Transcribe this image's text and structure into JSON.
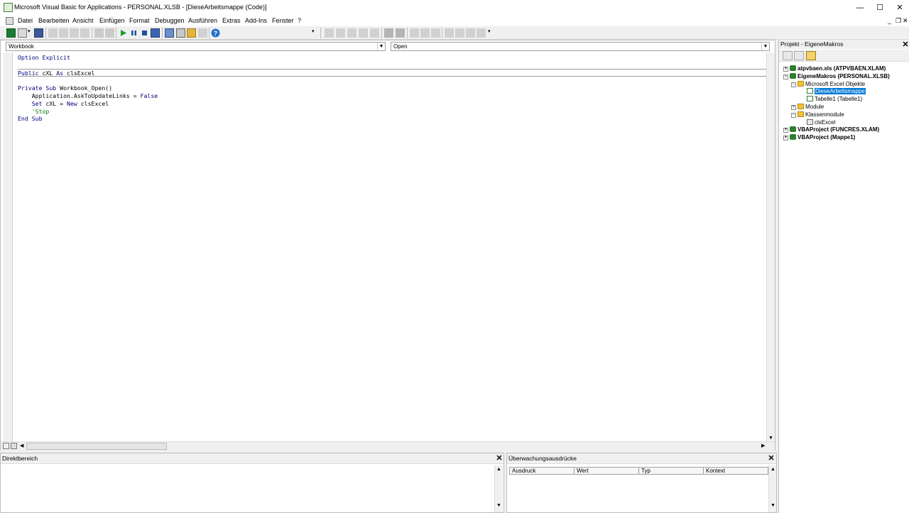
{
  "window": {
    "title": "Microsoft Visual Basic for Applications - PERSONAL.XLSB - [DieseArbeitsmappe (Code)]",
    "minimize": "—",
    "maximize": "☐",
    "close": "✕"
  },
  "menubar": {
    "items": [
      "Datei",
      "Bearbeiten",
      "Ansicht",
      "Einfügen",
      "Format",
      "Debuggen",
      "Ausführen",
      "Extras",
      "Add-Ins",
      "Fenster",
      "?"
    ],
    "mdi_minimize": "_",
    "mdi_restore": "❐",
    "mdi_close": "✕"
  },
  "code_window": {
    "object_combo": "Workbook",
    "procedure_combo": "Open",
    "lines": [
      {
        "parts": [
          {
            "t": "Option Explicit",
            "c": "kw"
          }
        ]
      },
      {
        "parts": [
          {
            "t": "",
            "c": ""
          }
        ],
        "sep": true
      },
      {
        "parts": [
          {
            "t": "Public",
            "c": "kw"
          },
          {
            "t": " cXL ",
            "c": ""
          },
          {
            "t": "As",
            "c": "kw"
          },
          {
            "t": " clsExcel",
            "c": ""
          }
        ],
        "sep": true
      },
      {
        "parts": [
          {
            "t": "",
            "c": ""
          }
        ]
      },
      {
        "parts": [
          {
            "t": "Private Sub",
            "c": "kw"
          },
          {
            "t": " Workbook_Open()",
            "c": ""
          }
        ]
      },
      {
        "parts": [
          {
            "t": "    Application.AskToUpdateLinks = ",
            "c": ""
          },
          {
            "t": "False",
            "c": "kw"
          }
        ]
      },
      {
        "parts": [
          {
            "t": "    ",
            "c": ""
          },
          {
            "t": "Set",
            "c": "kw"
          },
          {
            "t": " cXL = ",
            "c": ""
          },
          {
            "t": "New",
            "c": "kw"
          },
          {
            "t": " clsExcel",
            "c": ""
          }
        ]
      },
      {
        "parts": [
          {
            "t": "    'Stop",
            "c": "cm"
          }
        ]
      },
      {
        "parts": [
          {
            "t": "End Sub",
            "c": "kw"
          }
        ]
      }
    ]
  },
  "project": {
    "title": "Projekt - EigeneMakros",
    "tree": [
      {
        "label": "atpvbaen.xls (ATPVBAEN.XLAM)",
        "level": 0,
        "exp": "+",
        "icon": "proj",
        "bold": true
      },
      {
        "label": "EigeneMakros (PERSONAL.XLSB)",
        "level": 0,
        "exp": "−",
        "icon": "proj",
        "bold": true
      },
      {
        "label": "Microsoft Excel Objekte",
        "level": 1,
        "exp": "−",
        "icon": "folder"
      },
      {
        "label": "DieseArbeitsmappe",
        "level": 2,
        "exp": "",
        "icon": "sheet",
        "selected": true
      },
      {
        "label": "Tabelle1 (Tabelle1)",
        "level": 2,
        "exp": "",
        "icon": "sheet"
      },
      {
        "label": "Module",
        "level": 1,
        "exp": "+",
        "icon": "folder"
      },
      {
        "label": "Klassenmodule",
        "level": 1,
        "exp": "−",
        "icon": "folder"
      },
      {
        "label": "clsExcel",
        "level": 2,
        "exp": "",
        "icon": "cls"
      },
      {
        "label": "VBAProject (FUNCRES.XLAM)",
        "level": 0,
        "exp": "+",
        "icon": "proj",
        "bold": true
      },
      {
        "label": "VBAProject (Mappe1)",
        "level": 0,
        "exp": "+",
        "icon": "proj",
        "bold": true
      }
    ]
  },
  "immediate": {
    "title": "Direktbereich"
  },
  "watch": {
    "title": "Überwachungsausdrücke",
    "columns": [
      "Ausdruck",
      "Wert",
      "Typ",
      "Kontext"
    ]
  },
  "colors": {
    "keyword": "#00007f",
    "comment": "#007f00",
    "selection": "#0078d7"
  }
}
